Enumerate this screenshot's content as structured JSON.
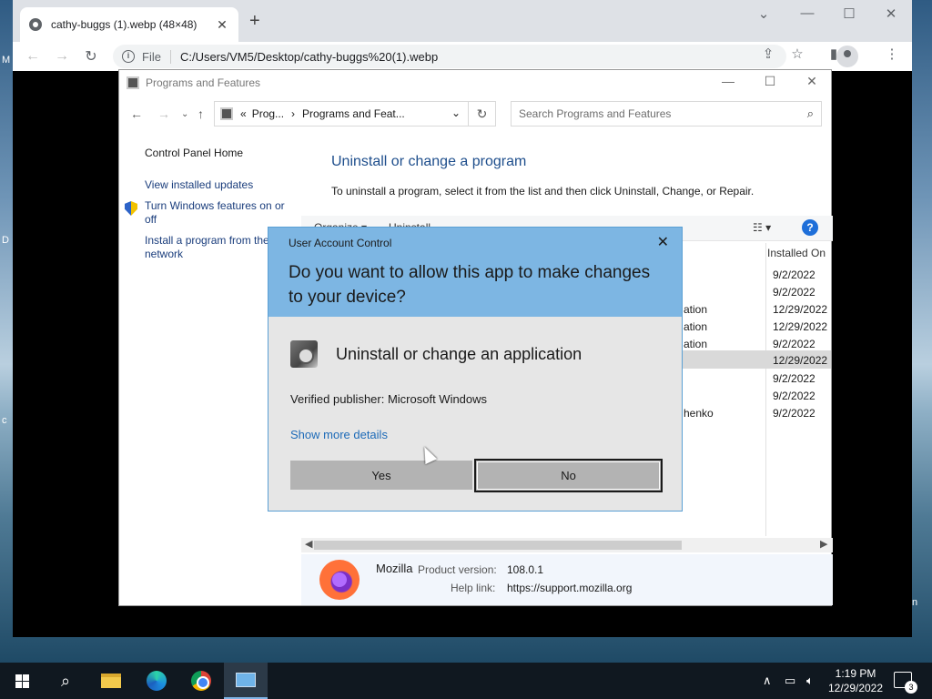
{
  "desktop": {
    "labels": [
      "M",
      "D",
      "c",
      "n"
    ]
  },
  "chrome": {
    "tab_title": "cathy-buggs (1).webp (48×48)",
    "tab_close": "✕",
    "new_tab": "+",
    "scheme": "File",
    "url": "C:/Users/VM5/Desktop/cathy-buggs%20(1).webp",
    "min": "⌄",
    "minimize": "—",
    "maximize": "☐",
    "close": "✕"
  },
  "pf_window": {
    "title": "Programs and Features",
    "breadcrumb_prefix": "«",
    "breadcrumb_1": "Prog...",
    "breadcrumb_sep": "›",
    "breadcrumb_2": "Programs and Feat...",
    "search_placeholder": "Search Programs and Features",
    "left_links": {
      "home": "Control Panel Home",
      "updates": "View installed updates",
      "features": "Turn Windows features on or off",
      "install": "Install a program from the network"
    },
    "heading": "Uninstall or change a program",
    "description": "To uninstall a program, select it from the list and then click Uninstall, Change, or Repair.",
    "cmd_organize": "Organize ▾",
    "cmd_uninstall": "Uninstall",
    "column_installed_on": "Installed On",
    "rows": [
      {
        "name": "",
        "date": "9/2/2022"
      },
      {
        "name": "",
        "date": "9/2/2022"
      },
      {
        "name": "ation",
        "date": "12/29/2022"
      },
      {
        "name": "ation",
        "date": "12/29/2022"
      },
      {
        "name": "ation",
        "date": "9/2/2022"
      },
      {
        "name": "",
        "date": "12/29/2022"
      },
      {
        "name": "",
        "date": "9/2/2022"
      },
      {
        "name": "",
        "date": "9/2/2022"
      },
      {
        "name": "henko",
        "date": "9/2/2022"
      }
    ],
    "details": {
      "publisher": "Mozilla",
      "product_version_label": "Product version:",
      "product_version": "108.0.1",
      "help_link_label": "Help link:",
      "help_link": "https://support.mozilla.org"
    }
  },
  "uac": {
    "header_label": "User Account Control",
    "question": "Do you want to allow this app to make changes to your device?",
    "app_name": "Uninstall or change an application",
    "publisher": "Verified publisher: Microsoft Windows",
    "show_more": "Show more details",
    "yes": "Yes",
    "no": "No",
    "accent": "#7db6e3"
  },
  "taskbar": {
    "time": "1:19 PM",
    "date": "12/29/2022",
    "notification_count": "3"
  }
}
